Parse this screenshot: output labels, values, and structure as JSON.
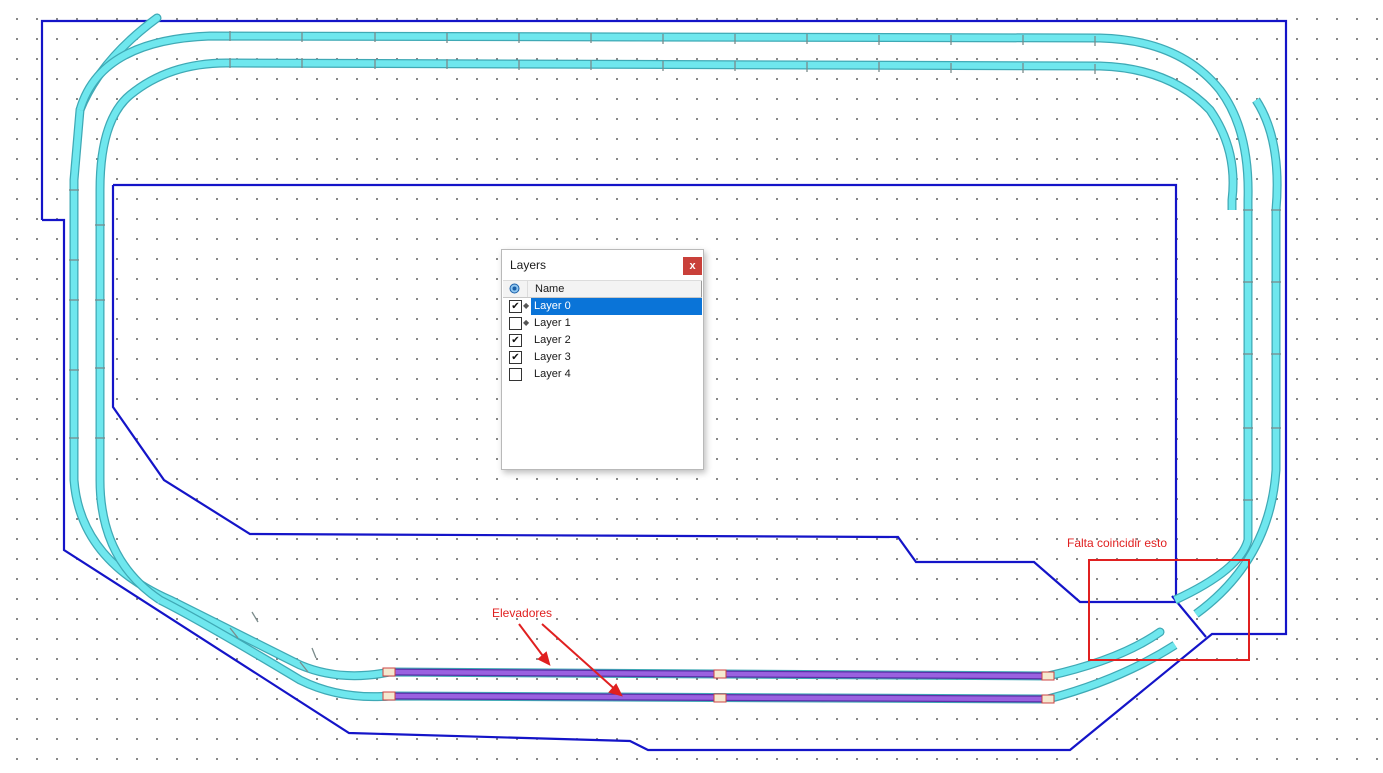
{
  "annotations": {
    "mismatch_note": "Falta coincidir esto",
    "elevators_note": "Elevadores"
  },
  "layers_panel": {
    "title": "Layers",
    "close_label": "x",
    "columns": {
      "visibility_icon": "visibility-icon",
      "name": "Name"
    },
    "layers": [
      {
        "name": "Layer 0",
        "visible": true,
        "marker": "◆",
        "selected": true
      },
      {
        "name": "Layer 1",
        "visible": false,
        "marker": "◆",
        "selected": false
      },
      {
        "name": "Layer 2",
        "visible": true,
        "marker": "",
        "selected": false
      },
      {
        "name": "Layer 3",
        "visible": true,
        "marker": "",
        "selected": false
      },
      {
        "name": "Layer 4",
        "visible": false,
        "marker": "",
        "selected": false
      }
    ]
  },
  "colors": {
    "baseboard_outline": "#1414c8",
    "track": "#6fe7ee",
    "track_edge": "#3fa9b5",
    "elevator_track": "#8e4fd6",
    "annotation": "#e02020",
    "selection": "#0a74d8"
  }
}
